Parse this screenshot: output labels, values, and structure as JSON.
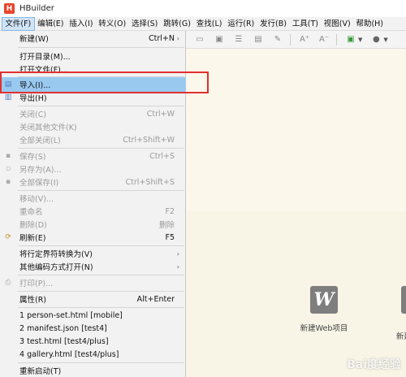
{
  "app": {
    "title": "HBuilder",
    "logo_letter": "H"
  },
  "menubar": [
    {
      "label": "文件(F)"
    },
    {
      "label": "编辑(E)"
    },
    {
      "label": "插入(I)"
    },
    {
      "label": "转义(O)"
    },
    {
      "label": "选择(S)"
    },
    {
      "label": "跳转(G)"
    },
    {
      "label": "查找(L)"
    },
    {
      "label": "运行(R)"
    },
    {
      "label": "发行(B)"
    },
    {
      "label": "工具(T)"
    },
    {
      "label": "视图(V)"
    },
    {
      "label": "帮助(H)"
    }
  ],
  "file_menu": {
    "items": [
      {
        "label": "新建(W)",
        "shortcut": "Ctrl+N",
        "arrow": "›",
        "icon": "none",
        "enabled": true
      },
      {
        "label": "打开目录(M)...",
        "shortcut": "",
        "icon": "none",
        "enabled": true
      },
      {
        "label": "打开文件(F)...",
        "shortcut": "",
        "icon": "none",
        "enabled": true
      },
      {
        "label": "导入(I)...",
        "shortcut": "",
        "icon": "import-icon",
        "enabled": true,
        "highlighted": true
      },
      {
        "label": "导出(H)",
        "shortcut": "",
        "icon": "export-icon",
        "enabled": true
      },
      {
        "label": "关闭(C)",
        "shortcut": "Ctrl+W",
        "icon": "none",
        "enabled": false
      },
      {
        "label": "关闭其他文件(K)",
        "shortcut": "",
        "icon": "none",
        "enabled": false
      },
      {
        "label": "全部关闭(L)",
        "shortcut": "Ctrl+Shift+W",
        "icon": "none",
        "enabled": false
      },
      {
        "label": "保存(S)",
        "shortcut": "Ctrl+S",
        "icon": "save-icon",
        "enabled": false
      },
      {
        "label": "另存为(A)...",
        "shortcut": "",
        "icon": "save-as-icon",
        "enabled": false
      },
      {
        "label": "全部保存(I)",
        "shortcut": "Ctrl+Shift+S",
        "icon": "save-all-icon",
        "enabled": false
      },
      {
        "label": "移动(V)...",
        "shortcut": "",
        "icon": "none",
        "enabled": false
      },
      {
        "label": "重命名",
        "shortcut": "F2",
        "icon": "none",
        "enabled": false
      },
      {
        "label": "删除(D)",
        "shortcut": "删除",
        "icon": "none",
        "enabled": false
      },
      {
        "label": "刷新(E)",
        "shortcut": "F5",
        "icon": "refresh-icon",
        "enabled": true
      },
      {
        "label": "将行定界符转换为(V)",
        "shortcut": "",
        "arrow": "›",
        "icon": "none",
        "enabled": true
      },
      {
        "label": "其他编码方式打开(N)",
        "shortcut": "",
        "arrow": "›",
        "icon": "none",
        "enabled": true
      },
      {
        "label": "打印(P)...",
        "shortcut": "",
        "icon": "print-icon",
        "enabled": false
      },
      {
        "label": "属性(R)",
        "shortcut": "Alt+Enter",
        "icon": "none",
        "enabled": true
      },
      {
        "label": "1 person-set.html  [mobile]",
        "shortcut": "",
        "icon": "none",
        "enabled": true
      },
      {
        "label": "2 manifest.json  [test4]",
        "shortcut": "",
        "icon": "none",
        "enabled": true
      },
      {
        "label": "3 test.html  [test4/plus]",
        "shortcut": "",
        "icon": "none",
        "enabled": true
      },
      {
        "label": "4 gallery.html  [test4/plus]",
        "shortcut": "",
        "icon": "none",
        "enabled": true
      },
      {
        "label": "重新启动(T)",
        "shortcut": "",
        "icon": "none",
        "enabled": true
      }
    ]
  },
  "welcome": {
    "new_web_project": "新建Web项目",
    "second_label": "新建"
  },
  "watermark": "Bai度经验",
  "colors": {
    "highlight": "#99c9ef",
    "annotation_box": "#e03030",
    "editor_bg": "#f8f4e6"
  }
}
